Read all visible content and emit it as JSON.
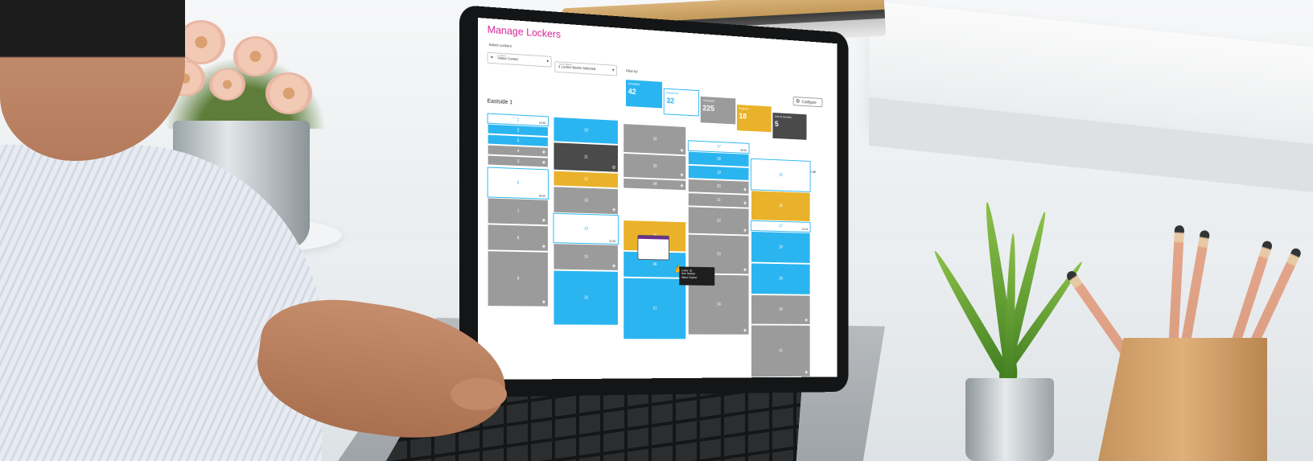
{
  "app": {
    "title": "Manage Lockers",
    "select_lockers_label": "Select Lockers",
    "location": {
      "caption": "Location",
      "value": "Visitor Center"
    },
    "bank": {
      "caption": "Locker Banks",
      "value": "4 Locker Banks Selected"
    },
    "filter_label": "Filter by",
    "configure_label": "Configure",
    "bank_title": "Eastside 1",
    "select_all_label": "Select all",
    "pager": "‹ ● ○ ○ ○ ○ ○ ○ ›"
  },
  "filters": [
    {
      "label": "Available",
      "count": "42",
      "status": "avail"
    },
    {
      "label": "Reserved",
      "count": "32",
      "status": "resv"
    },
    {
      "label": "Occupied",
      "count": "225",
      "status": "occ"
    },
    {
      "label": "Expired",
      "count": "18",
      "status": "exp"
    },
    {
      "label": "Out of service",
      "count": "5",
      "status": "oos"
    }
  ],
  "lockers": [
    {
      "id": "1",
      "status": "resv",
      "time": "16:32"
    },
    {
      "id": "2",
      "status": "avail"
    },
    {
      "id": "5",
      "status": "avail"
    },
    {
      "id": "4",
      "status": "occ",
      "icon": "box-icon"
    },
    {
      "id": "3",
      "status": "occ",
      "icon": "box-icon"
    },
    {
      "id": "6",
      "status": "resv",
      "time": "09:10"
    },
    {
      "id": "7",
      "status": "occ",
      "icon": "box-icon"
    },
    {
      "id": "8",
      "status": "occ",
      "icon": "box-icon"
    },
    {
      "id": "9",
      "status": "occ",
      "icon": "box-icon"
    },
    {
      "id": "10",
      "status": "avail"
    },
    {
      "id": "11",
      "status": "oos",
      "icon": "blocked-icon"
    },
    {
      "id": "12",
      "status": "exp"
    },
    {
      "id": "13",
      "status": "occ",
      "icon": "box-icon"
    },
    {
      "id": "14",
      "status": "resv",
      "time": "12:32"
    },
    {
      "id": "15",
      "status": "occ",
      "icon": "box-icon"
    },
    {
      "id": "16",
      "status": "avail"
    },
    {
      "id": "32",
      "status": "occ",
      "icon": "box-icon"
    },
    {
      "id": "33",
      "status": "occ",
      "icon": "box-icon"
    },
    {
      "id": "34",
      "status": "occ",
      "icon": "box-icon"
    },
    {
      "id": "35",
      "status": "exp"
    },
    {
      "id": "36",
      "status": "avail"
    },
    {
      "id": "37",
      "status": "avail"
    },
    {
      "id": "17",
      "status": "resv",
      "time": "09:00"
    },
    {
      "id": "18",
      "status": "avail"
    },
    {
      "id": "19",
      "status": "avail"
    },
    {
      "id": "20",
      "status": "occ",
      "icon": "box-icon"
    },
    {
      "id": "21",
      "status": "occ",
      "icon": "box-icon"
    },
    {
      "id": "22",
      "status": "occ",
      "icon": "box-icon"
    },
    {
      "id": "23",
      "status": "occ",
      "icon": "box-icon"
    },
    {
      "id": "24",
      "status": "occ",
      "icon": "box-icon"
    },
    {
      "id": "25",
      "status": "resv"
    },
    {
      "id": "26",
      "status": "exp"
    },
    {
      "id": "27",
      "status": "resv",
      "time": "01:23"
    },
    {
      "id": "28",
      "status": "avail"
    },
    {
      "id": "29",
      "status": "avail"
    },
    {
      "id": "30",
      "status": "occ",
      "icon": "box-icon"
    },
    {
      "id": "31",
      "status": "occ",
      "icon": "box-icon"
    }
  ],
  "tooltip": {
    "line1": "Locker: 35",
    "line2": "Size: Medium",
    "line3": "Status: Expired"
  },
  "colors": {
    "available": "#2bb5f0",
    "occupied": "#9b9b9b",
    "expired": "#eab22a",
    "out_of_service": "#4a4a4a",
    "title": "#d6249a"
  }
}
